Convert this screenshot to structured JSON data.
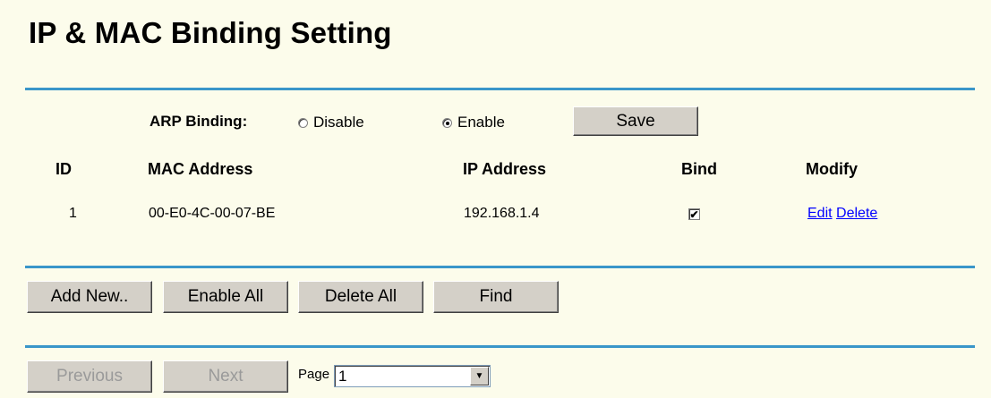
{
  "page": {
    "title": "IP & MAC Binding Setting"
  },
  "arp": {
    "label": "ARP Binding:",
    "options": [
      {
        "label": "Disable",
        "selected": false
      },
      {
        "label": "Enable",
        "selected": true
      }
    ],
    "save_label": "Save"
  },
  "table": {
    "headers": {
      "id": "ID",
      "mac": "MAC Address",
      "ip": "IP Address",
      "bind": "Bind",
      "modify": "Modify"
    },
    "rows": [
      {
        "id": "1",
        "mac": "00-E0-4C-00-07-BE",
        "ip": "192.168.1.4",
        "bind": true,
        "edit": "Edit",
        "delete": "Delete"
      }
    ]
  },
  "actions": {
    "add_new": "Add New..",
    "enable_all": "Enable All",
    "delete_all": "Delete All",
    "find": "Find"
  },
  "pager": {
    "previous": "Previous",
    "next": "Next",
    "page_label": "Page",
    "page_value": "1"
  },
  "colors": {
    "background": "#fcfceb",
    "divider": "#3a96c9",
    "link": "#0000ff",
    "button": "#d4d0c8"
  }
}
